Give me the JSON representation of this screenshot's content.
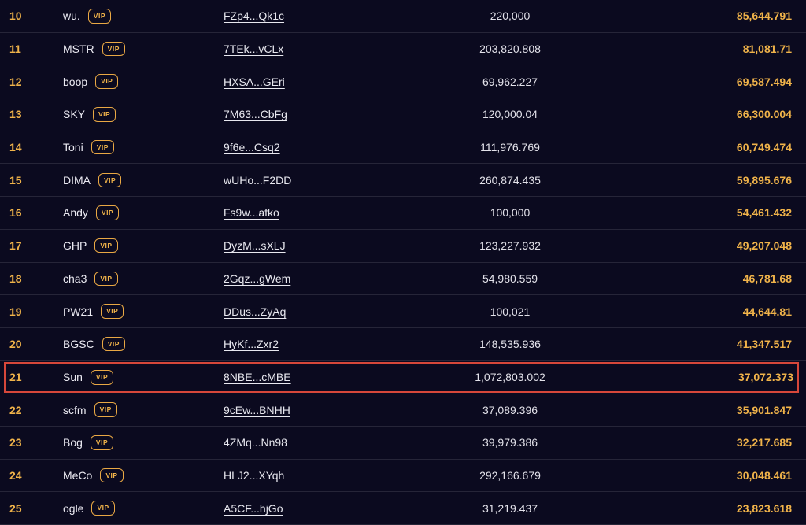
{
  "rows": [
    {
      "rank": "10",
      "name": "wu.",
      "vip": "VIP",
      "address": "FZp4...Qk1c",
      "amount": "220,000",
      "value": "85,644.791"
    },
    {
      "rank": "11",
      "name": "MSTR",
      "vip": "VIP",
      "address": "7TEk...vCLx",
      "amount": "203,820.808",
      "value": "81,081.71"
    },
    {
      "rank": "12",
      "name": "boop",
      "vip": "VIP",
      "address": "HXSA...GEri",
      "amount": "69,962.227",
      "value": "69,587.494"
    },
    {
      "rank": "13",
      "name": "SKY",
      "vip": "VIP",
      "address": "7M63...CbFg",
      "amount": "120,000.04",
      "value": "66,300.004"
    },
    {
      "rank": "14",
      "name": "Toni",
      "vip": "VIP",
      "address": "9f6e...Csq2",
      "amount": "111,976.769",
      "value": "60,749.474"
    },
    {
      "rank": "15",
      "name": "DIMA",
      "vip": "VIP",
      "address": "wUHo...F2DD",
      "amount": "260,874.435",
      "value": "59,895.676"
    },
    {
      "rank": "16",
      "name": "Andy",
      "vip": "VIP",
      "address": "Fs9w...afko",
      "amount": "100,000",
      "value": "54,461.432"
    },
    {
      "rank": "17",
      "name": "GHP",
      "vip": "VIP",
      "address": "DyzM...sXLJ",
      "amount": "123,227.932",
      "value": "49,207.048"
    },
    {
      "rank": "18",
      "name": "cha3",
      "vip": "VIP",
      "address": "2Gqz...gWem",
      "amount": "54,980.559",
      "value": "46,781.68"
    },
    {
      "rank": "19",
      "name": "PW21",
      "vip": "VIP",
      "address": "DDus...ZyAq",
      "amount": "100,021",
      "value": "44,644.81"
    },
    {
      "rank": "20",
      "name": "BGSC",
      "vip": "VIP",
      "address": "HyKf...Zxr2",
      "amount": "148,535.936",
      "value": "41,347.517"
    },
    {
      "rank": "21",
      "name": "Sun",
      "vip": "VIP",
      "address": "8NBE...cMBE",
      "amount": "1,072,803.002",
      "value": "37,072.373"
    },
    {
      "rank": "22",
      "name": "scfm",
      "vip": "VIP",
      "address": "9cEw...BNHH",
      "amount": "37,089.396",
      "value": "35,901.847"
    },
    {
      "rank": "23",
      "name": "Bog",
      "vip": "VIP",
      "address": "4ZMq...Nn98",
      "amount": "39,979.386",
      "value": "32,217.685"
    },
    {
      "rank": "24",
      "name": "MeCo",
      "vip": "VIP",
      "address": "HLJ2...XYqh",
      "amount": "292,166.679",
      "value": "30,048.461"
    },
    {
      "rank": "25",
      "name": "ogle",
      "vip": "VIP",
      "address": "A5CF...hjGo",
      "amount": "31,219.437",
      "value": "23,823.618"
    }
  ],
  "highlighted_rank": "21",
  "colors": {
    "background": "#0b0a1f",
    "accent": "#f0b34a",
    "highlight_border": "#d6473a"
  }
}
